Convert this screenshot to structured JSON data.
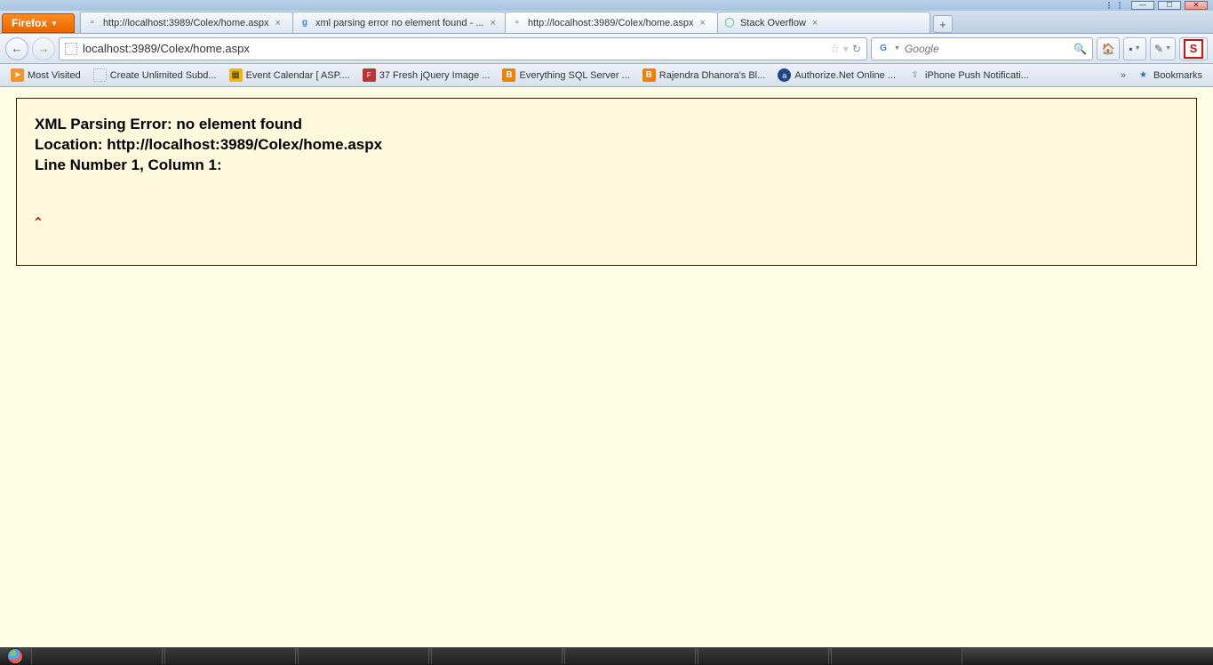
{
  "firefox_button": "Firefox",
  "tabs": [
    {
      "label": "http://localhost:3989/Colex/home.aspx",
      "icon": "page",
      "active": false
    },
    {
      "label": "xml parsing error no element found - ...",
      "icon": "google",
      "active": false
    },
    {
      "label": "http://localhost:3989/Colex/home.aspx",
      "icon": "page",
      "active": true
    },
    {
      "label": "Stack Overflow",
      "icon": "so",
      "active": false
    }
  ],
  "url": {
    "value": "localhost:3989/Colex/home.aspx"
  },
  "search": {
    "placeholder": "Google"
  },
  "bookmarks": [
    {
      "label": "Most Visited",
      "icon": "feed"
    },
    {
      "label": "Create Unlimited Subd...",
      "icon": "blank"
    },
    {
      "label": "Event Calendar [ ASP....",
      "icon": "cal"
    },
    {
      "label": "37 Fresh jQuery Image ...",
      "icon": "fresh"
    },
    {
      "label": "Everything SQL Server ...",
      "icon": "blogger"
    },
    {
      "label": "Rajendra Dhanora's Bl...",
      "icon": "blogger"
    },
    {
      "label": "Authorize.Net Online ...",
      "icon": "auth"
    },
    {
      "label": "iPhone Push Notificati...",
      "icon": "push"
    }
  ],
  "bookmarks_menu": "Bookmarks",
  "error": {
    "line1": "XML Parsing Error: no element found",
    "line2": "Location: http://localhost:3989/Colex/home.aspx",
    "line3": "Line Number 1, Column 1:",
    "caret": "^"
  }
}
